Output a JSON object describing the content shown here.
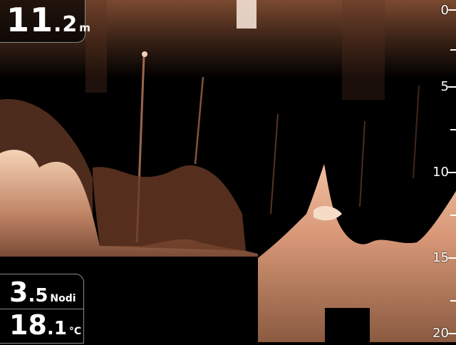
{
  "depth": {
    "value": "11",
    "decimal": ".2",
    "unit": "m"
  },
  "speed": {
    "value": "3",
    "decimal": ".5",
    "unit": "Nodi"
  },
  "water_temp": {
    "value": "18",
    "decimal": ".1",
    "unit": "°C"
  },
  "depth_scale": {
    "labels": [
      "0",
      "5",
      "10",
      "15",
      "20"
    ],
    "min": 0,
    "max": 20
  },
  "colors": {
    "sonar_palette": "#e0a080",
    "background": "#000000",
    "panel_border": "#8a8a8a"
  }
}
